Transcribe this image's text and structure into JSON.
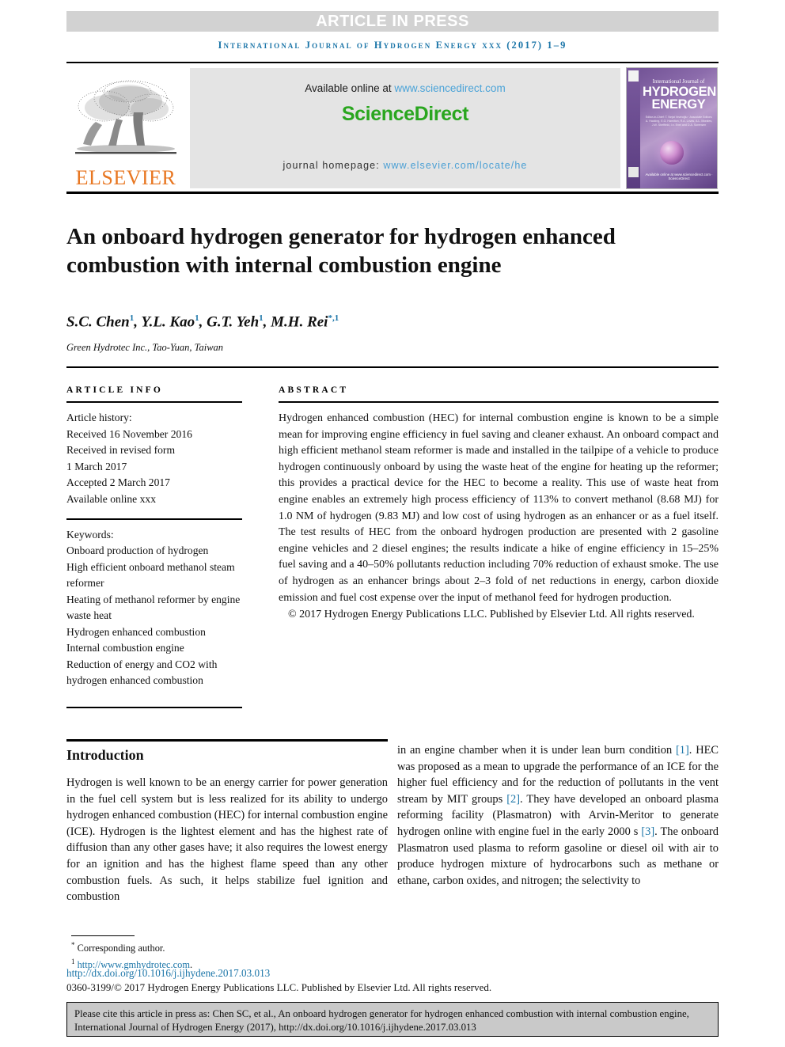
{
  "banner": {
    "text": "ARTICLE IN PRESS",
    "background": "#d2d2d2"
  },
  "running_head": "International Journal of Hydrogen Energy xxx (2017) 1–9",
  "masthead": {
    "publisher_name": "ELSEVIER",
    "publisher_color": "#e87722",
    "available_label": "Available online at ",
    "available_url": "www.sciencedirect.com",
    "sciencedirect_logo": "ScienceDirect",
    "sciencedirect_color": "#2aa61f",
    "homepage_label": "journal homepage: ",
    "homepage_url": "www.elsevier.com/locate/he",
    "cover": {
      "line_small": "International Journal of",
      "line_big_1": "HYDROGEN",
      "line_big_2": "ENERGY",
      "editors": "Editor-in-Chief: T. Nejat Veziroğlu · Associate Editors: A. Hacking, E.G. Hamilton, R.A. Lovas, A.L. Morales, J.W. Sheffield, I.n. Enel and D.A. Sorensen",
      "science_direct": "Available online at www.sciencedirect.com · ScienceDirect"
    }
  },
  "title": "An onboard hydrogen generator for hydrogen enhanced combustion with internal combustion engine",
  "authors": [
    {
      "name": "S.C. Chen",
      "sup": "1"
    },
    {
      "name": "Y.L. Kao",
      "sup": "1"
    },
    {
      "name": "G.T. Yeh",
      "sup": "1"
    },
    {
      "name": "M.H. Rei",
      "sup": "*,1"
    }
  ],
  "affiliation": "Green Hydrotec Inc., Tao-Yuan, Taiwan",
  "article_info": {
    "heading": "ARTICLE INFO",
    "history_label": "Article history:",
    "history": [
      "Received 16 November 2016",
      "Received in revised form",
      "1 March 2017",
      "Accepted 2 March 2017",
      "Available online xxx"
    ],
    "keywords_label": "Keywords:",
    "keywords": [
      "Onboard production of hydrogen",
      "High efficient onboard methanol steam reformer",
      "Heating of methanol reformer by engine waste heat",
      "Hydrogen enhanced combustion",
      "Internal combustion engine",
      "Reduction of energy and CO2 with hydrogen enhanced combustion"
    ]
  },
  "abstract": {
    "heading": "ABSTRACT",
    "body": "Hydrogen enhanced combustion (HEC) for internal combustion engine is known to be a simple mean for improving engine efficiency in fuel saving and cleaner exhaust. An onboard compact and high efficient methanol steam reformer is made and installed in the tailpipe of a vehicle to produce hydrogen continuously onboard by using the waste heat of the engine for heating up the reformer; this provides a practical device for the HEC to become a reality. This use of waste heat from engine enables an extremely high process efficiency of 113% to convert methanol (8.68 MJ) for 1.0 NM of hydrogen (9.83 MJ) and low cost of using hydrogen as an enhancer or as a fuel itself. The test results of HEC from the onboard hydrogen production are presented with 2 gasoline engine vehicles and 2 diesel engines; the results indicate a hike of engine efficiency in 15–25% fuel saving and a 40–50% pollutants reduction including 70% reduction of exhaust smoke. The use of hydrogen as an enhancer brings about 2–3 fold of net reductions in energy, carbon dioxide emission and fuel cost expense over the input of methanol feed for hydrogen production.",
    "copyright": "© 2017 Hydrogen Energy Publications LLC. Published by Elsevier Ltd. All rights reserved."
  },
  "introduction": {
    "heading": "Introduction",
    "left_paragraph": "Hydrogen is well known to be an energy carrier for power generation in the fuel cell system but is less realized for its ability to undergo hydrogen enhanced combustion (HEC) for internal combustion engine (ICE). Hydrogen is the lightest element and has the highest rate of diffusion than any other gases have; it also requires the lowest energy for an ignition and has the highest flame speed than any other combustion fuels. As such, it helps stabilize fuel ignition and combustion",
    "right_segments": [
      {
        "type": "text",
        "value": "in an engine chamber when it is under lean burn condition "
      },
      {
        "type": "ref",
        "value": "[1]"
      },
      {
        "type": "text",
        "value": ". HEC was proposed as a mean to upgrade the performance of an ICE for the higher fuel efficiency and for the reduction of pollutants in the vent stream by MIT groups "
      },
      {
        "type": "ref",
        "value": "[2]"
      },
      {
        "type": "text",
        "value": ". They have developed an onboard plasma reforming facility (Plasmatron) with Arvin-Meritor to generate hydrogen online with engine fuel in the early 2000 s "
      },
      {
        "type": "ref",
        "value": "[3]"
      },
      {
        "type": "text",
        "value": ". The onboard Plasmatron used plasma to reform gasoline or diesel oil with air to produce hydrogen mixture of hydrocarbons such as methane or ethane, carbon oxides, and nitrogen; the selectivity to"
      }
    ]
  },
  "footnotes": {
    "corresponding_marker": "*",
    "corresponding_text": "Corresponding author.",
    "url_marker": "1",
    "url": "http://www.gmhydrotec.com",
    "url_suffix": ".",
    "doi": "http://dx.doi.org/10.1016/j.ijhydene.2017.03.013",
    "issn_line": "0360-3199/© 2017 Hydrogen Energy Publications LLC. Published by Elsevier Ltd. All rights reserved."
  },
  "cite_box": {
    "text": "Please cite this article in press as: Chen SC, et al., An onboard hydrogen generator for hydrogen enhanced combustion with internal combustion engine, International Journal of Hydrogen Energy (2017), http://dx.doi.org/10.1016/j.ijhydene.2017.03.013"
  },
  "colors": {
    "link_blue": "#1b75a8",
    "sd_green": "#2aa61f",
    "elsevier_orange": "#e87722",
    "banner_grey": "#d2d2d2",
    "cite_grey": "#c9c9c9"
  }
}
